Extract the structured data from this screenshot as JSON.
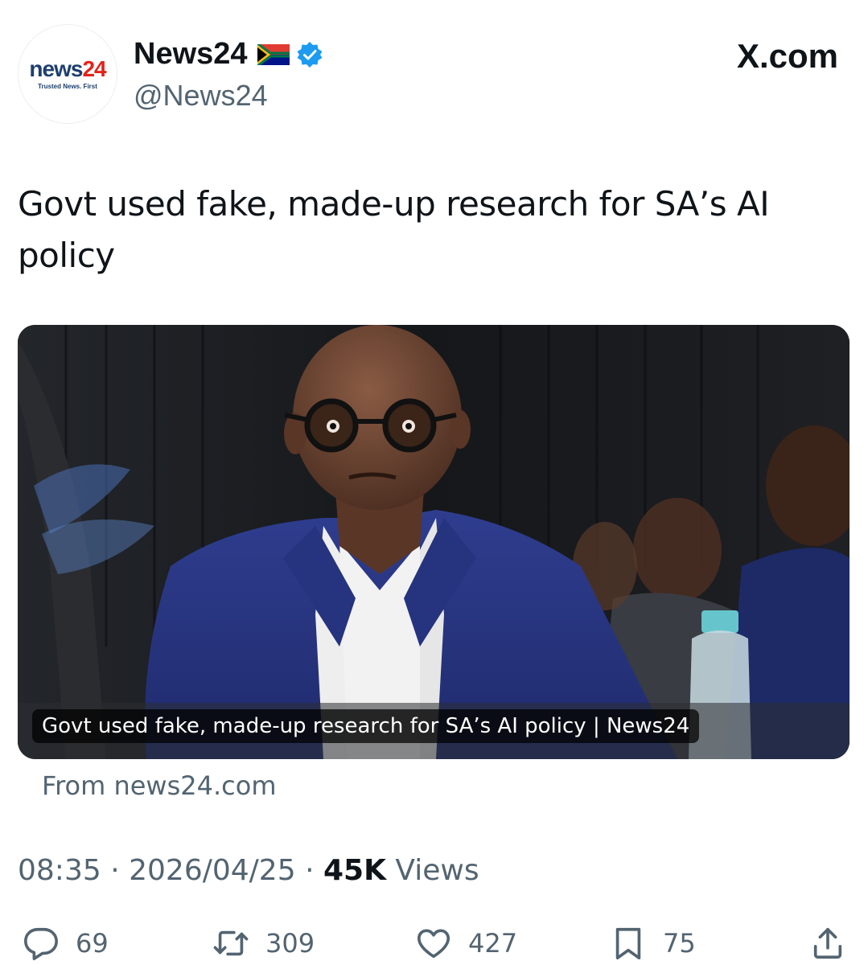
{
  "author": {
    "logo_word_part1": "news",
    "logo_word_part2": "24",
    "logo_tagline": "Trusted News. First",
    "display_name": "News24",
    "handle": "@News24",
    "flag": "south-africa-flag-icon",
    "verified": "verified-badge-icon"
  },
  "site_label": "X.com",
  "tweet": {
    "text": "Govt used fake, made-up research for SA’s AI policy"
  },
  "card": {
    "caption": "Govt used fake, made-up research for SA’s AI policy | News24",
    "source": "From news24.com"
  },
  "meta": {
    "time": "08:35",
    "date": "2026/04/25",
    "separator": "·",
    "views_count": "45K",
    "views_label": "Views"
  },
  "actions": {
    "replies": "69",
    "reposts": "309",
    "likes": "427",
    "bookmarks": "75"
  },
  "colors": {
    "text_primary": "#0f1419",
    "text_secondary": "#536471",
    "verified_blue": "#1d9bf0",
    "logo_blue": "#1d3f6e",
    "logo_red": "#e2231a"
  }
}
